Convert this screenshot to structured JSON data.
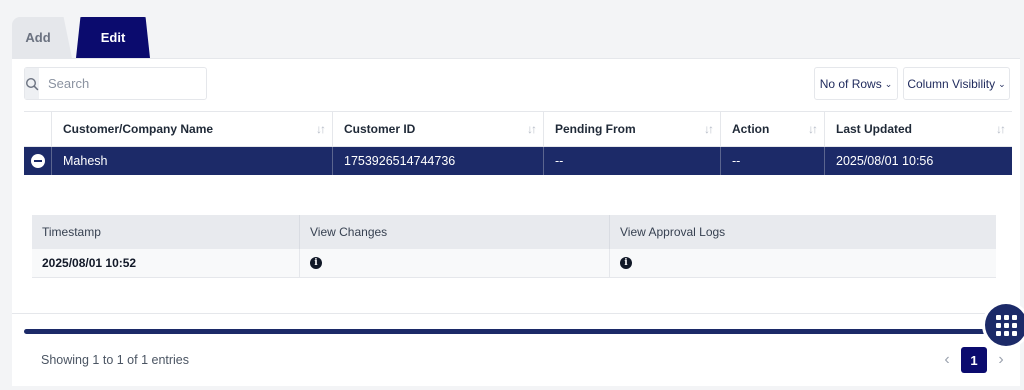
{
  "tabs": [
    {
      "label": "Add",
      "active": false
    },
    {
      "label": "Edit",
      "active": true
    }
  ],
  "toolbar": {
    "search_placeholder": "Search",
    "search_value": "",
    "rows_label": "No of Rows",
    "columns_label": "Column Visibility"
  },
  "table": {
    "columns": [
      "Customer/Company Name",
      "Customer ID",
      "Pending From",
      "Action",
      "Last Updated"
    ],
    "rows": [
      {
        "name": "Mahesh",
        "customer_id": "1753926514744736",
        "pending_from": "--",
        "action": "--",
        "last_updated": "2025/08/01 10:56"
      }
    ]
  },
  "detail": {
    "columns": [
      "Timestamp",
      "View Changes",
      "View Approval Logs"
    ],
    "rows": [
      {
        "timestamp": "2025/08/01 10:52"
      }
    ]
  },
  "footer": {
    "info": "Showing 1 to 1 of 1 entries",
    "current_page": "1"
  },
  "colors": {
    "primary": "#0b0b6e",
    "row_selected": "#1c2a68"
  },
  "icons": [
    "search-icon",
    "sort-icon",
    "collapse-icon",
    "info-icon",
    "chevron-down-icon",
    "grid-menu-icon",
    "chevron-left-icon",
    "chevron-right-icon"
  ]
}
